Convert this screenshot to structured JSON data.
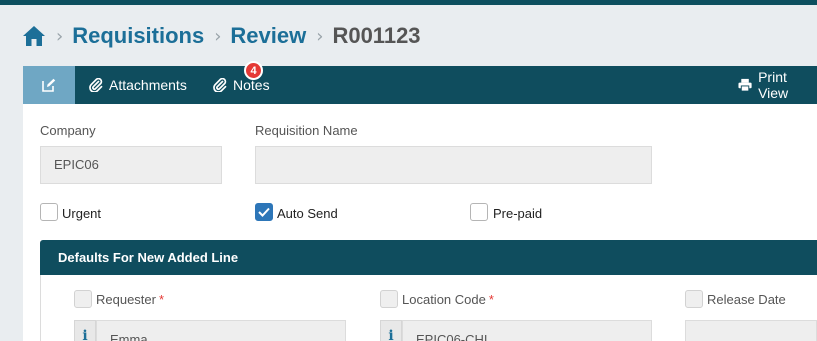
{
  "breadcrumb": {
    "home_icon": "home-icon",
    "items": [
      "Requisitions",
      "Review"
    ],
    "current": "R001123"
  },
  "tabs": {
    "edit_icon": "edit-icon",
    "attachments": "Attachments",
    "notes": "Notes",
    "notes_badge": "4",
    "print_view": "Print View"
  },
  "form": {
    "company_label": "Company",
    "company_value": "EPIC06",
    "requisition_name_label": "Requisition Name",
    "requisition_name_value": "",
    "urgent_label": "Urgent",
    "urgent_checked": false,
    "auto_send_label": "Auto Send",
    "auto_send_checked": true,
    "prepaid_label": "Pre-paid",
    "prepaid_checked": false
  },
  "defaults": {
    "title": "Defaults For New Added Line",
    "requester_label": "Requester",
    "requester_value": "Emma",
    "location_label": "Location Code",
    "location_value": "EPIC06-CHI",
    "release_label": "Release Date",
    "release_value": "",
    "required_mark": "*",
    "info_glyph": "i"
  },
  "colors": {
    "primary_dark": "#0f4d5e",
    "link_blue": "#1c6f98",
    "active_tab": "#6fa7c4",
    "badge_red": "#e53935",
    "checkbox_blue": "#2d76b8"
  }
}
